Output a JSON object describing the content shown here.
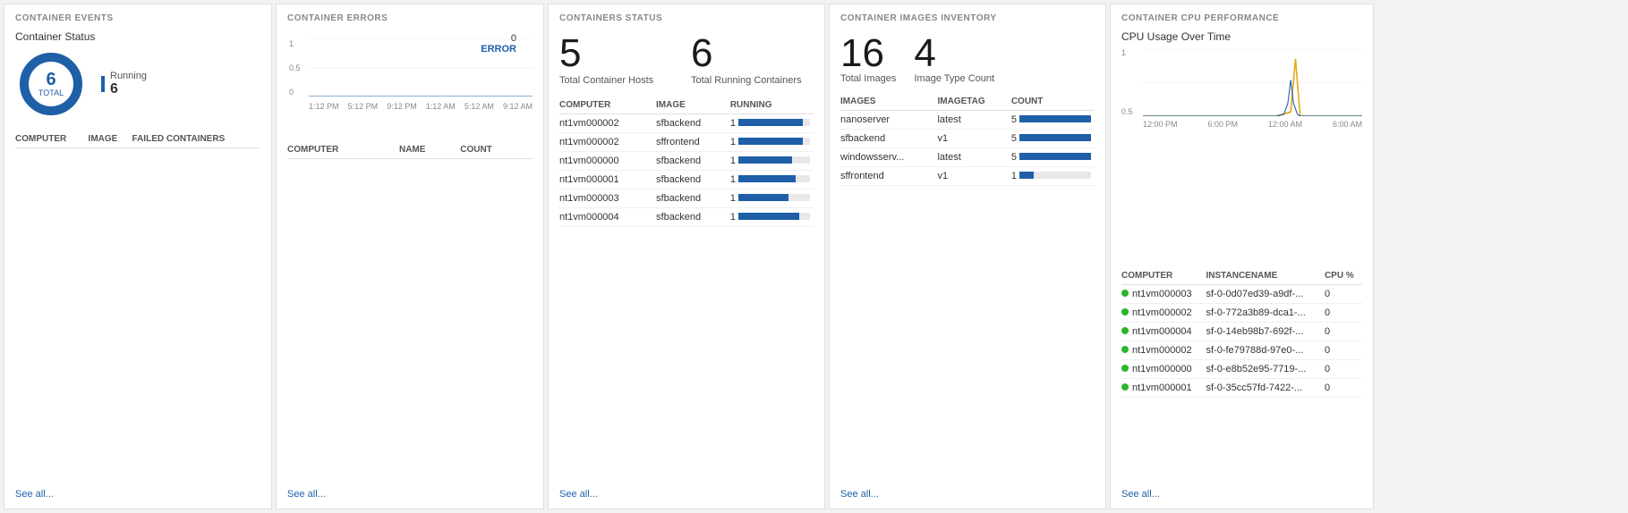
{
  "panels": {
    "events": {
      "title": "CONTAINER EVENTS",
      "subtitle": "Container Status",
      "donut": {
        "total": "6",
        "total_label": "TOTAL",
        "legend_label": "Running",
        "legend_value": "6"
      },
      "table": {
        "columns": [
          "COMPUTER",
          "IMAGE",
          "FAILED CONTAINERS"
        ],
        "rows": []
      },
      "see_all": "See all..."
    },
    "errors": {
      "title": "CONTAINER ERRORS",
      "error_num": "0",
      "error_label": "ERROR",
      "y_labels": [
        "1",
        "0.5",
        "0"
      ],
      "x_labels": [
        "1:12 PM",
        "5:12 PM",
        "9:12 PM",
        "1:12 AM",
        "5:12 AM",
        "9:12 AM"
      ],
      "table": {
        "columns": [
          "COMPUTER",
          "NAME",
          "COUNT"
        ],
        "rows": []
      },
      "see_all": "See all..."
    },
    "status": {
      "title": "CONTAINERS STATUS",
      "stat1_num": "5",
      "stat1_desc": "Total Container Hosts",
      "stat2_num": "6",
      "stat2_desc": "Total Running Containers",
      "table": {
        "columns": [
          "COMPUTER",
          "IMAGE",
          "RUNNING"
        ],
        "rows": [
          {
            "computer": "nt1vm000002",
            "image": "sfbackend",
            "running": "1",
            "bar": 90
          },
          {
            "computer": "nt1vm000002",
            "image": "sffrontend",
            "running": "1",
            "bar": 90
          },
          {
            "computer": "nt1vm000000",
            "image": "sfbackend",
            "running": "1",
            "bar": 75
          },
          {
            "computer": "nt1vm000001",
            "image": "sfbackend",
            "running": "1",
            "bar": 80
          },
          {
            "computer": "nt1vm000003",
            "image": "sfbackend",
            "running": "1",
            "bar": 70
          },
          {
            "computer": "nt1vm000004",
            "image": "sfbackend",
            "running": "1",
            "bar": 85
          }
        ]
      },
      "see_all": "See all..."
    },
    "inventory": {
      "title": "CONTAINER IMAGES INVENTORY",
      "stat1_num": "16",
      "stat1_desc": "Total Images",
      "stat2_num": "4",
      "stat2_desc": "Image Type Count",
      "table": {
        "columns": [
          "IMAGES",
          "IMAGETAG",
          "COUNT"
        ],
        "rows": [
          {
            "image": "nanoserver",
            "tag": "latest",
            "count": "5",
            "bar": 100
          },
          {
            "image": "sfbackend",
            "tag": "v1",
            "count": "5",
            "bar": 100
          },
          {
            "image": "windowsserv...",
            "tag": "latest",
            "count": "5",
            "bar": 100
          },
          {
            "image": "sffrontend",
            "tag": "v1",
            "count": "1",
            "bar": 20
          }
        ]
      },
      "see_all": "See all..."
    },
    "cpu": {
      "title": "CONTAINER CPU PERFORMANCE",
      "chart_title": "CPU Usage Over Time",
      "y_labels": [
        "1",
        "0.5"
      ],
      "x_labels": [
        "12:00 PM",
        "6:00 PM",
        "12:00 AM",
        "6:00 AM"
      ],
      "table": {
        "columns": [
          "COMPUTER",
          "INSTANCENAME",
          "CPU %"
        ],
        "rows": [
          {
            "computer": "nt1vm000003",
            "instance": "sf-0-0d07ed39-a9df-...",
            "cpu": "0"
          },
          {
            "computer": "nt1vm000002",
            "instance": "sf-0-772a3b89-dca1-...",
            "cpu": "0"
          },
          {
            "computer": "nt1vm000004",
            "instance": "sf-0-14eb98b7-692f-...",
            "cpu": "0"
          },
          {
            "computer": "nt1vm000002",
            "instance": "sf-0-fe79788d-97e0-...",
            "cpu": "0"
          },
          {
            "computer": "nt1vm000000",
            "instance": "sf-0-e8b52e95-7719-...",
            "cpu": "0"
          },
          {
            "computer": "nt1vm000001",
            "instance": "sf-0-35cc57fd-7422-...",
            "cpu": "0"
          }
        ]
      },
      "see_all": "See all..."
    }
  }
}
